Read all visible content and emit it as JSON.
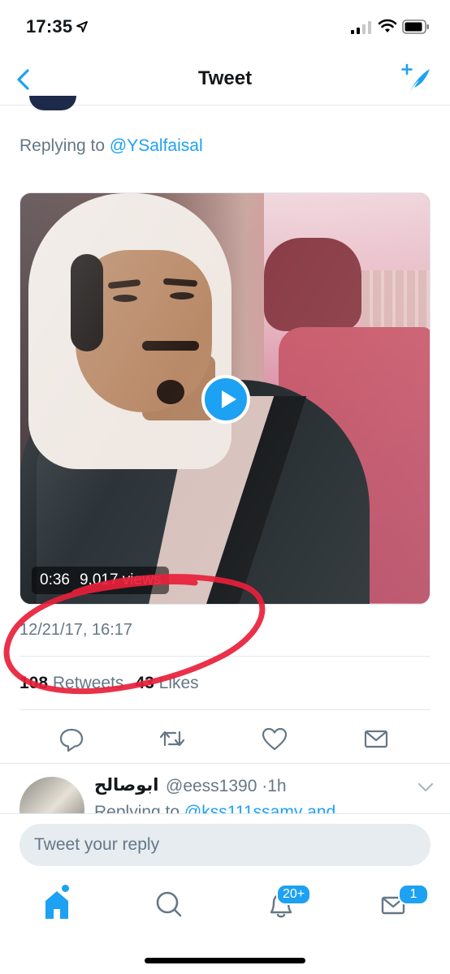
{
  "status_bar": {
    "time": "17:35"
  },
  "nav": {
    "title": "Tweet"
  },
  "tweet": {
    "replying_prefix": "Replying to",
    "replying_handle": "@YSalfaisal",
    "video": {
      "duration": "0:36",
      "views": "9,017 views"
    },
    "timestamp": "12/21/17, 16:17",
    "stats": {
      "retweets_count": "108",
      "retweets_label": "Retweets",
      "likes_count": "43",
      "likes_label": "Likes"
    }
  },
  "reply": {
    "name": "ابوصالح",
    "handle": "@eess1390",
    "dot": "·",
    "time": "1h",
    "sub_prefix": "Replying to",
    "sub_handles": "@kss111ssamy and"
  },
  "composer": {
    "placeholder": "Tweet your reply"
  },
  "tabbar": {
    "notifications_badge": "20+",
    "messages_badge": "1"
  },
  "colors": {
    "accent": "#1da1f2",
    "secondary_text": "#657786",
    "annotation": "#e8203a"
  },
  "icons": [
    "location-arrow-icon",
    "signal-icon",
    "wifi-icon",
    "battery-icon",
    "back-chevron-icon",
    "compose-feather-icon",
    "play-icon",
    "reply-bubble-icon",
    "retweet-icon",
    "heart-icon",
    "envelope-icon",
    "chevron-down-icon",
    "home-icon",
    "search-icon",
    "bell-icon",
    "mail-icon"
  ]
}
